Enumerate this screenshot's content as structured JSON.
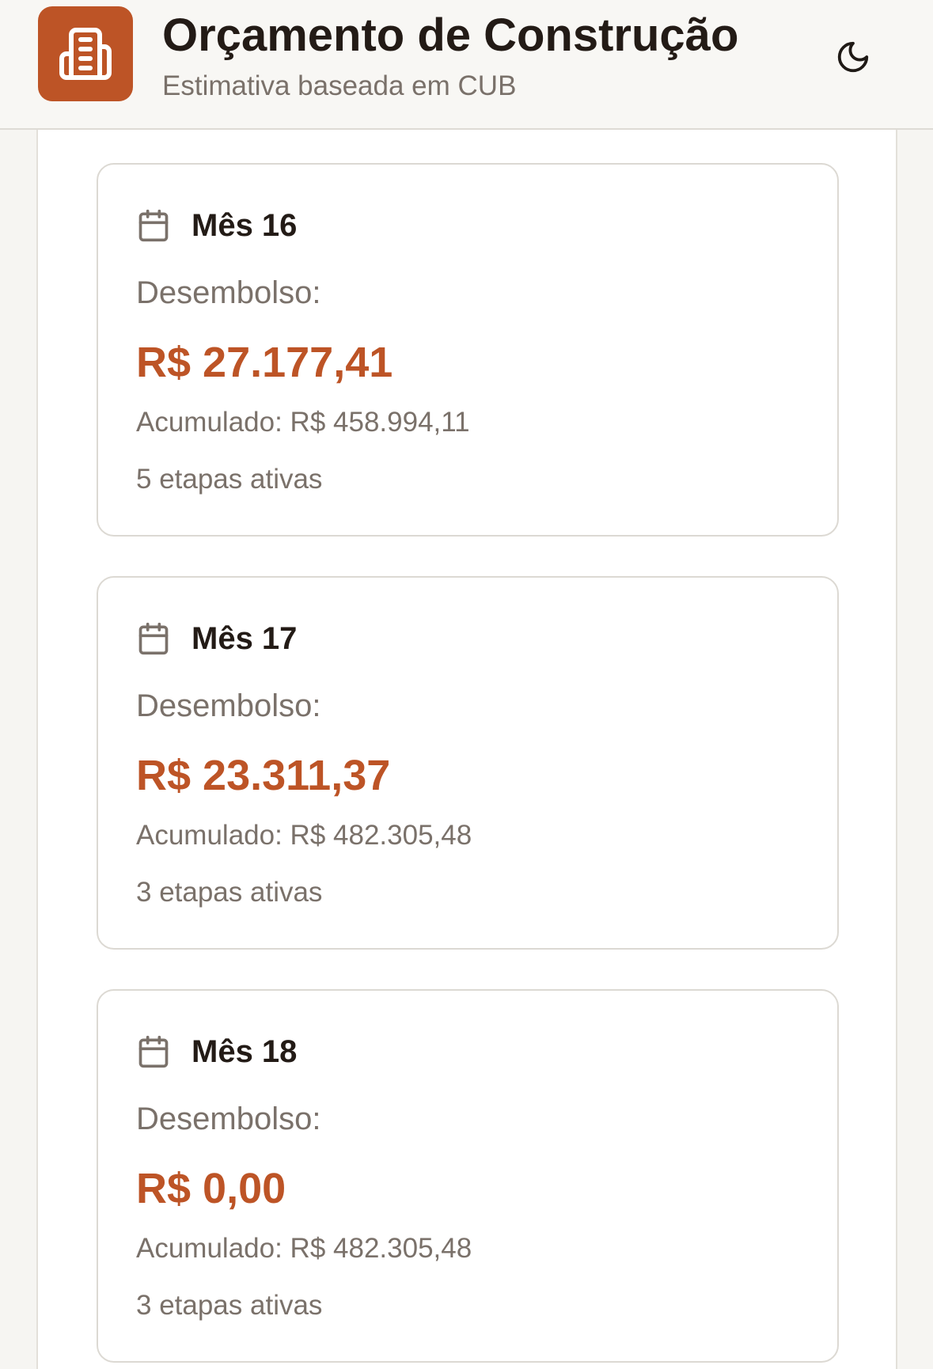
{
  "header": {
    "title": "Orçamento de Construção",
    "subtitle": "Estimativa baseada em CUB",
    "logo_icon": "building-icon",
    "theme_toggle_icon": "moon-icon"
  },
  "colors": {
    "accent": "#bd5426",
    "text_dark": "#231b16",
    "text_muted": "#7a716a",
    "card_border": "#dcd9d3"
  },
  "months": [
    {
      "title": "Mês 16",
      "disbursement_label": "Desembolso:",
      "disbursement_value": "R$ 27.177,41",
      "cumulative": "Acumulado: R$ 458.994,11",
      "active_stages": "5 etapas ativas",
      "icon": "calendar-icon"
    },
    {
      "title": "Mês 17",
      "disbursement_label": "Desembolso:",
      "disbursement_value": "R$ 23.311,37",
      "cumulative": "Acumulado: R$ 482.305,48",
      "active_stages": "3 etapas ativas",
      "icon": "calendar-icon"
    },
    {
      "title": "Mês 18",
      "disbursement_label": "Desembolso:",
      "disbursement_value": "R$ 0,00",
      "cumulative": "Acumulado: R$ 482.305,48",
      "active_stages": "3 etapas ativas",
      "icon": "calendar-icon"
    }
  ]
}
